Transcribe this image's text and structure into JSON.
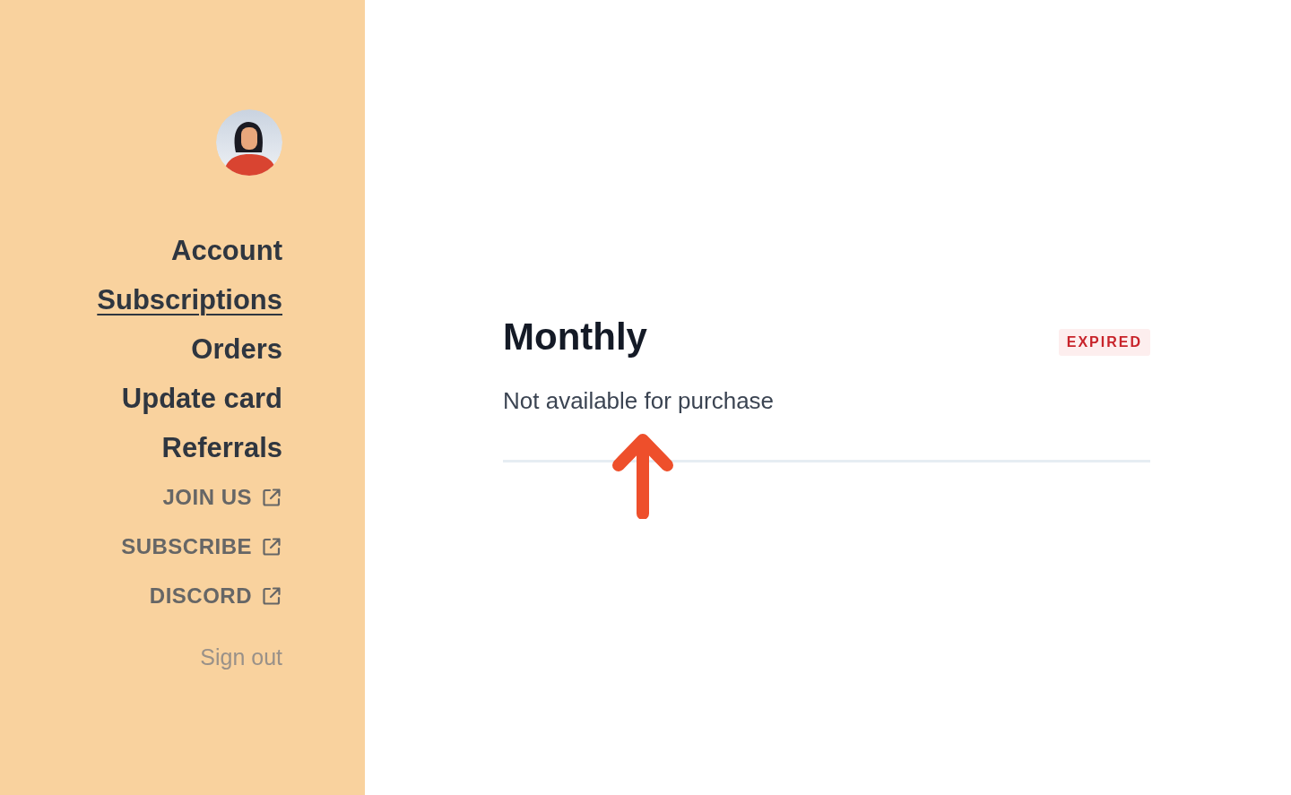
{
  "sidebar": {
    "nav_items": [
      {
        "label": "Account",
        "selected": false
      },
      {
        "label": "Subscriptions",
        "selected": true
      },
      {
        "label": "Orders",
        "selected": false
      },
      {
        "label": "Update card",
        "selected": false
      },
      {
        "label": "Referrals",
        "selected": false
      }
    ],
    "external_links": [
      "JOIN US",
      "SUBSCRIBE",
      "DISCORD"
    ],
    "sign_out": "Sign out"
  },
  "plan": {
    "title": "Monthly",
    "status": "EXPIRED",
    "note": "Not available for purchase"
  }
}
